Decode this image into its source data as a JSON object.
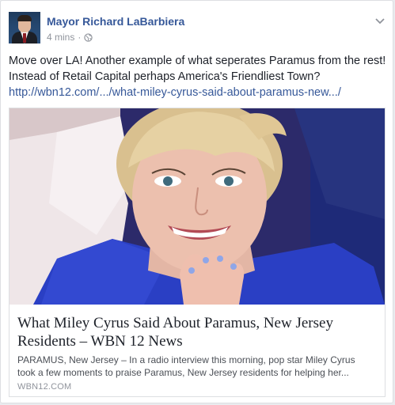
{
  "post": {
    "author": "Mayor Richard LaBarbiera",
    "timestamp": "4 mins",
    "separator": "·",
    "privacy_icon": "globe-icon",
    "menu_icon": "chevron-down-icon",
    "text_lines": [
      "Move over LA! Another example of what seperates Paramus from the rest!",
      "Instead of Retail Capital perhaps America's Friendliest Town?"
    ],
    "link_text": "http://wbn12.com/.../what-miley-cyrus-said-about-paramus-new.../"
  },
  "link_preview": {
    "headline": "What Miley Cyrus Said About Paramus, New Jersey Residents – WBN 12 News",
    "description_lines": [
      "PARAMUS, New Jersey – In a radio interview this morning, pop star Miley Cyrus",
      "took a few moments to praise Paramus, New Jersey residents for helping her..."
    ],
    "domain": "WBN12.COM"
  },
  "colors": {
    "author_link": "#365899",
    "body_text": "#1d2129",
    "meta_text": "#90949c",
    "card_border": "#dddfe2"
  }
}
